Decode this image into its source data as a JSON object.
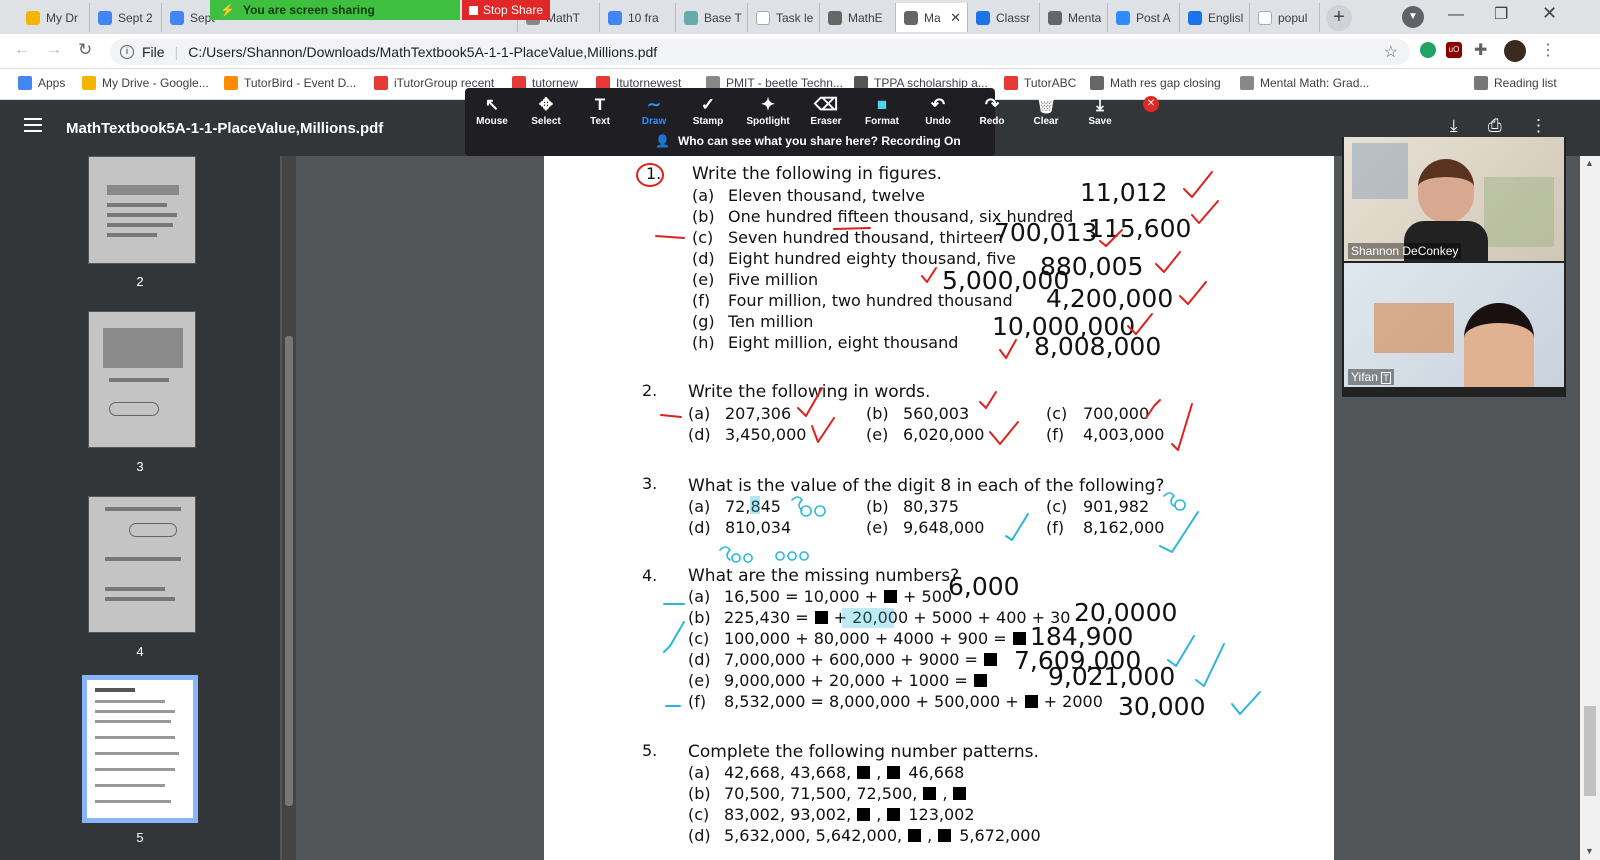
{
  "tabs": [
    {
      "label": "My Dr",
      "icon": "drive-icon"
    },
    {
      "label": "Sept 2",
      "icon": "docs-icon"
    },
    {
      "label": "Sept",
      "icon": "docs-icon"
    },
    {
      "label": "MathT",
      "icon": "pdf-icon"
    },
    {
      "label": "10 fra",
      "icon": "docs-icon"
    },
    {
      "label": "Base T",
      "icon": "base-icon"
    },
    {
      "label": "Task le",
      "icon": "task-icon"
    },
    {
      "label": "MathE",
      "icon": "web-icon"
    },
    {
      "label": "Ma",
      "icon": "web-icon"
    },
    {
      "label": "Classr",
      "icon": "classroom-icon"
    },
    {
      "label": "Menta",
      "icon": "web-icon"
    },
    {
      "label": "Post A",
      "icon": "zoom-icon"
    },
    {
      "label": "Englisl",
      "icon": "classroom-icon"
    },
    {
      "label": "popul",
      "icon": "google-icon"
    }
  ],
  "share": {
    "banner": "You are screen sharing",
    "stop": "Stop Share"
  },
  "address": {
    "file_label": "File",
    "url": "C:/Users/Shannon/Downloads/MathTextbook5A-1-1-PlaceValue,Millions.pdf"
  },
  "bookmarks": [
    {
      "label": "Apps"
    },
    {
      "label": "My Drive - Google..."
    },
    {
      "label": "TutorBird - Event D..."
    },
    {
      "label": "iTutorGroup recent"
    },
    {
      "label": "tutornew"
    },
    {
      "label": "Itutornewest"
    },
    {
      "label": "PMIT - beetle Techn..."
    },
    {
      "label": "TPPA scholarship a..."
    },
    {
      "label": "TutorABC"
    },
    {
      "label": "Math res gap closing"
    },
    {
      "label": "Mental Math: Grad..."
    },
    {
      "label": "Reading list"
    }
  ],
  "pdf": {
    "title": "MathTextbook5A-1-1-PlaceValue,Millions.pdf"
  },
  "annotate": {
    "tools": [
      "Mouse",
      "Select",
      "Text",
      "Draw",
      "Stamp",
      "Spotlight",
      "Eraser",
      "Format",
      "Undo",
      "Redo",
      "Clear",
      "Save"
    ],
    "notice": "Who can see what you share here? Recording On"
  },
  "thumbnails": [
    "2",
    "3",
    "4",
    "5"
  ],
  "video": {
    "p1": "Shannon DeConkey",
    "p2": "Yifan"
  },
  "document": {
    "q1": {
      "num": "1.",
      "title": "Write the following in figures.",
      "items": [
        {
          "l": "(a)",
          "t": "Eleven thousand, twelve",
          "a": "11,012"
        },
        {
          "l": "(b)",
          "t": "One hundred fifteen thousand, six hundred",
          "a": "115,600"
        },
        {
          "l": "(c)",
          "t": "Seven hundred thousand, thirteen",
          "a": "700,013"
        },
        {
          "l": "(d)",
          "t": "Eight hundred eighty thousand, five",
          "a": "880,005"
        },
        {
          "l": "(e)",
          "t": "Five million",
          "a": "5,000,000"
        },
        {
          "l": "(f)",
          "t": "Four million, two hundred thousand",
          "a": "4,200,000"
        },
        {
          "l": "(g)",
          "t": "Ten million",
          "a": "10,000,000"
        },
        {
          "l": "(h)",
          "t": "Eight million, eight thousand",
          "a": "8,008,000"
        }
      ]
    },
    "q2": {
      "num": "2.",
      "title": "Write the following in words.",
      "items": [
        {
          "l": "(a)",
          "t": "207,306"
        },
        {
          "l": "(b)",
          "t": "560,003"
        },
        {
          "l": "(c)",
          "t": "700,000"
        },
        {
          "l": "(d)",
          "t": "3,450,000"
        },
        {
          "l": "(e)",
          "t": "6,020,000"
        },
        {
          "l": "(f)",
          "t": "4,003,000"
        }
      ]
    },
    "q3": {
      "num": "3.",
      "title": "What is the value of the digit 8 in each of the following?",
      "items": [
        {
          "l": "(a)",
          "t": "72,845"
        },
        {
          "l": "(b)",
          "t": "80,375"
        },
        {
          "l": "(c)",
          "t": "901,982"
        },
        {
          "l": "(d)",
          "t": "810,034"
        },
        {
          "l": "(e)",
          "t": "9,648,000"
        },
        {
          "l": "(f)",
          "t": "8,162,000"
        }
      ],
      "notes": [
        "800",
        "80",
        "800 000"
      ]
    },
    "q4": {
      "num": "4.",
      "title": "What are the missing numbers?",
      "items": [
        {
          "l": "(a)",
          "pre": "16,500 = 10,000 +",
          "post": "+ 500",
          "a": "6,000"
        },
        {
          "l": "(b)",
          "pre": "225,430 =",
          "post": "+ 20,000 + 5000 + 400 + 30",
          "a": "20,0000"
        },
        {
          "l": "(c)",
          "pre": "100,000 + 80,000 + 4000 + 900 =",
          "post": "",
          "a": "184,900"
        },
        {
          "l": "(d)",
          "pre": "7,000,000 + 600,000 + 9000 =",
          "post": "",
          "a": "7,609,000"
        },
        {
          "l": "(e)",
          "pre": "9,000,000 + 20,000 + 1000 =",
          "post": "",
          "a": "9,021,000"
        },
        {
          "l": "(f)",
          "pre": "8,532,000 = 8,000,000 + 500,000 +",
          "post": "+ 2000",
          "a": "30,000"
        }
      ]
    },
    "q5": {
      "num": "5.",
      "title": "Complete the following number patterns.",
      "items": [
        {
          "l": "(a)",
          "pre": "42,668,  43,668,",
          "post": "46,668"
        },
        {
          "l": "(b)",
          "pre": "70,500,  71,500,  72,500,",
          "post": ""
        },
        {
          "l": "(c)",
          "pre": "83,002,  93,002,",
          "post": "123,002"
        },
        {
          "l": "(d)",
          "pre": "5,632,000,  5,642,000,",
          "post": "5,672,000"
        }
      ]
    }
  },
  "colors": {
    "red_ink": "#e0201c",
    "cyan_ink": "#2ab6d8",
    "zoom_green": "#3fbf3f",
    "zoom_red": "#e02828",
    "chrome_tabbar": "#dfe1e5"
  }
}
